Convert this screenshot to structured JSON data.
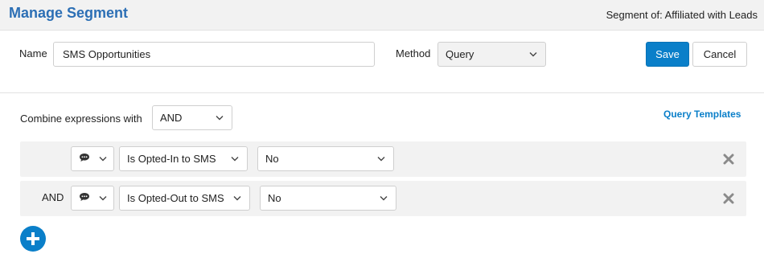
{
  "header": {
    "title": "Manage Segment",
    "segment_of": "Segment of: Affiliated with Leads"
  },
  "form": {
    "name_label": "Name",
    "name_value": "SMS Opportunities",
    "method_label": "Method",
    "method_value": "Query",
    "save_label": "Save",
    "cancel_label": "Cancel"
  },
  "query": {
    "combine_label": "Combine expressions with",
    "combine_value": "AND",
    "templates_link": "Query Templates",
    "rows": [
      {
        "conjunction": "",
        "field_icon": "speech-bubble-icon",
        "field": "Is Opted-In to SMS",
        "value": "No"
      },
      {
        "conjunction": "AND",
        "field_icon": "speech-bubble-icon",
        "field": "Is Opted-Out to SMS",
        "value": "No"
      }
    ]
  },
  "colors": {
    "title": "#2c6fb5",
    "accent": "#0a7fc9",
    "row_bg": "#f2f2f2",
    "remove_icon": "#8a8a8a"
  }
}
